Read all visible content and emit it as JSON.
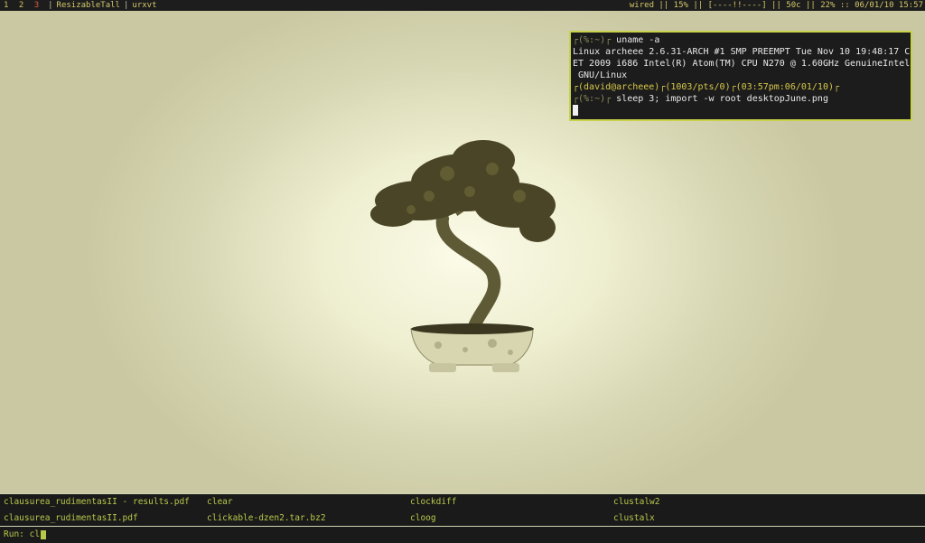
{
  "topbar": {
    "workspaces": [
      "1",
      "2",
      "3"
    ],
    "layout": "ResizableTall",
    "window": "urxvt",
    "status": "wired || 15% || [----!!----] || 50c || 22% :: 06/01/10 15:57"
  },
  "terminal": {
    "prompt1": "┌(%:~)┌",
    "cmd1": " uname -a",
    "output1": "Linux archeee 2.6.31-ARCH #1 SMP PREEMPT Tue Nov 10 19:48:17 C",
    "output2": "ET 2009 i686 Intel(R) Atom(TM) CPU N270 @ 1.60GHz GenuineIntel",
    "output3": " GNU/Linux",
    "info_user": "┌(david@archeee)┌(1003/pts/0)┌(03:57pm:06/01/10)┌",
    "prompt2": "┌(%:~)┌",
    "cmd2": " sleep 3; import -w root desktopJune.png"
  },
  "completions": [
    "clausurea_rudimentasII - results.pdf",
    "clear",
    "clockdiff",
    "clustalw2",
    "clausurea_rudimentasII.pdf",
    "clickable-dzen2.tar.bz2",
    "cloog",
    "clustalx"
  ],
  "run_prompt": {
    "label": "Run:",
    "input": "cl"
  },
  "colors": {
    "accent": "#c8d24a",
    "bar_bg": "#1d1d1d",
    "current_workspace": "#e05a3a"
  }
}
